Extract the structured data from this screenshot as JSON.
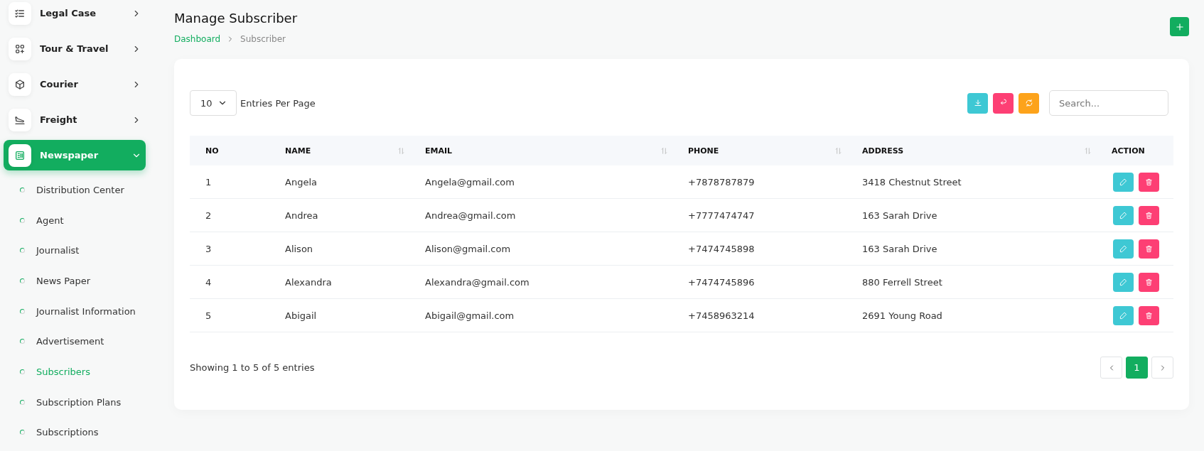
{
  "sidebar": {
    "items": [
      {
        "label": "Legal Case",
        "selected": false,
        "expanded": false
      },
      {
        "label": "Tour & Travel",
        "selected": false,
        "expanded": false
      },
      {
        "label": "Courier",
        "selected": false,
        "expanded": false
      },
      {
        "label": "Freight",
        "selected": false,
        "expanded": false
      },
      {
        "label": "Newspaper",
        "selected": true,
        "expanded": true,
        "children": [
          {
            "label": "Distribution Center",
            "selected": false
          },
          {
            "label": "Agent",
            "selected": false
          },
          {
            "label": "Journalist",
            "selected": false
          },
          {
            "label": "News Paper",
            "selected": false
          },
          {
            "label": "Journalist Information",
            "selected": false
          },
          {
            "label": "Advertisement",
            "selected": false
          },
          {
            "label": "Subscribers",
            "selected": true
          },
          {
            "label": "Subscription Plans",
            "selected": false
          },
          {
            "label": "Subscriptions",
            "selected": false
          }
        ]
      }
    ]
  },
  "header": {
    "title": "Manage Subscriber",
    "breadcrumb": [
      {
        "label": "Dashboard",
        "kind": "link"
      },
      {
        "label": "Subscriber",
        "kind": "current"
      }
    ]
  },
  "toolbar": {
    "page_size": "10",
    "page_size_label": "Entries Per Page",
    "buttons": [
      {
        "kind": "download",
        "color": "#3ec8d4"
      },
      {
        "kind": "undo",
        "color": "#fd3f74"
      },
      {
        "kind": "refresh",
        "color": "#fda31b"
      }
    ],
    "search": {
      "placeholder": "Search..."
    }
  },
  "table": {
    "columns": [
      {
        "label": "NO",
        "sortable": false
      },
      {
        "label": "NAME",
        "sortable": true
      },
      {
        "label": "EMAIL",
        "sortable": true
      },
      {
        "label": "PHONE",
        "sortable": true
      },
      {
        "label": "ADDRESS",
        "sortable": true
      },
      {
        "label": "ACTION",
        "sortable": false
      }
    ],
    "rows": [
      [
        "1",
        "Angela",
        "Angela@gmail.com",
        "+7878787879",
        "3418 Chestnut Street"
      ],
      [
        "2",
        "Andrea",
        "Andrea@gmail.com",
        "+7777474747",
        "163 Sarah Drive"
      ],
      [
        "3",
        "Alison",
        "Alison@gmail.com",
        "+7474745898",
        "163 Sarah Drive"
      ],
      [
        "4",
        "Alexandra",
        "Alexandra@gmail.com",
        "+7474745896",
        "880 Ferrell Street"
      ],
      [
        "5",
        "Abigail",
        "Abigail@gmail.com",
        "+7458963214",
        "2691 Young Road"
      ]
    ]
  },
  "footer": {
    "summary": "Showing 1 to 5 of 5 entries",
    "pages": [
      {
        "label": "1",
        "selected": true
      }
    ]
  }
}
